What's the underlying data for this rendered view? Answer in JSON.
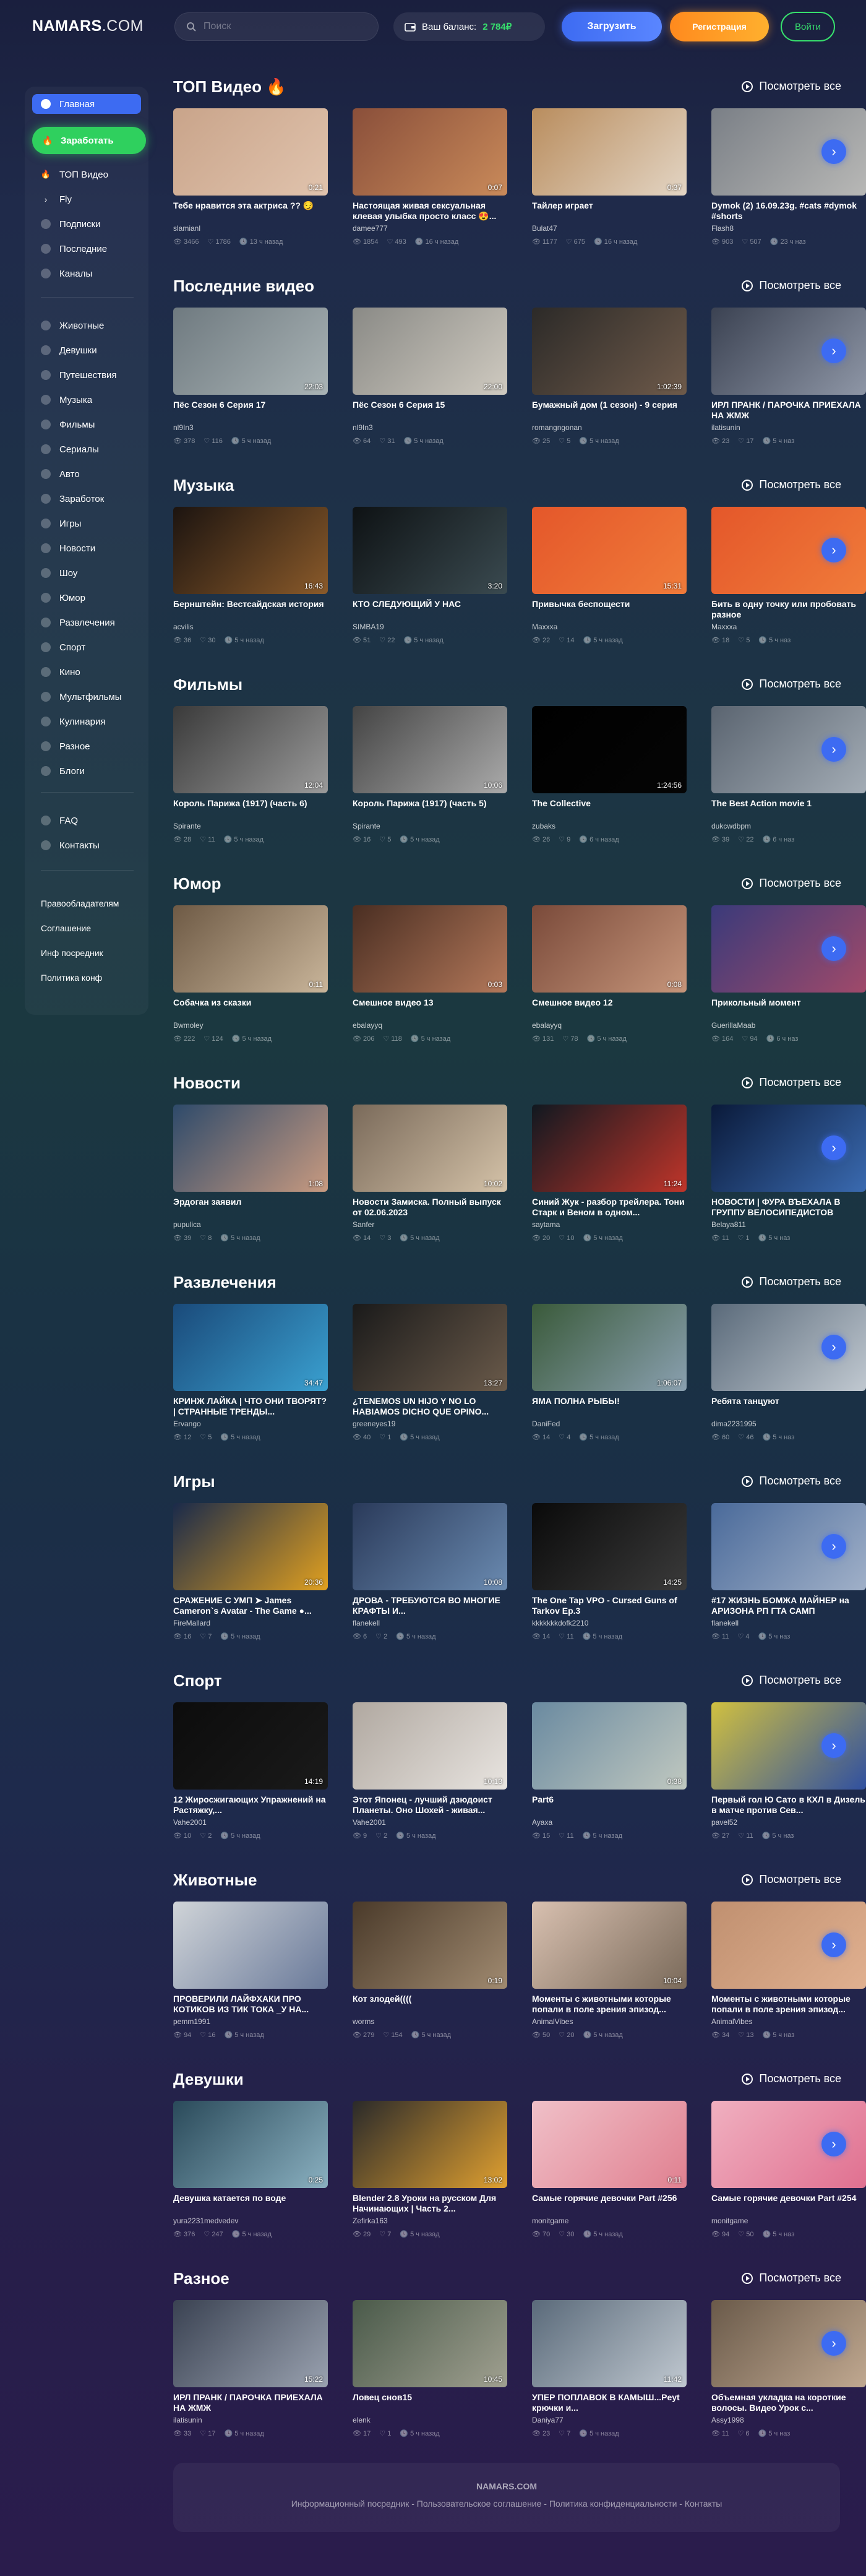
{
  "header": {
    "logo_main": "NAMARS",
    "logo_domain": ".COM",
    "search_placeholder": "Поиск",
    "balance_label": "Ваш баланс:",
    "balance_value": "2 784₽",
    "upload_label": "Загрузить",
    "register_label": "Регистрация",
    "login_label": "Войти"
  },
  "sidebar": {
    "main_items": [
      {
        "label": "Главная",
        "icon": "home-icon"
      },
      {
        "label": "Заработать",
        "icon": "fire-icon"
      },
      {
        "label": "ТОП Видео",
        "icon": "fire-icon"
      },
      {
        "label": "Fly",
        "icon": "chevron-icon"
      },
      {
        "label": "Подписки",
        "icon": "subscriptions-icon"
      },
      {
        "label": "Последние",
        "icon": "clock-icon"
      },
      {
        "label": "Каналы",
        "icon": "channels-icon"
      }
    ],
    "categories": [
      "Животные",
      "Девушки",
      "Путешествия",
      "Музыка",
      "Фильмы",
      "Сериалы",
      "Авто",
      "Заработок",
      "Игры",
      "Новости",
      "Шоу",
      "Юмор",
      "Развлечения",
      "Спорт",
      "Кино",
      "Мультфильмы",
      "Кулинария",
      "Разное",
      "Блоги"
    ],
    "info_items": [
      "FAQ",
      "Контакты"
    ],
    "legal_links": [
      "Правообладателям",
      "Соглашение",
      "Инф посредник",
      "Политика конф"
    ]
  },
  "see_all_label": "Посмотреть все",
  "sections": [
    {
      "title": "ТОП Видео 🔥",
      "videos": [
        {
          "title": "Тебе нравится эта актриса ?? 😏",
          "author": "slamianl",
          "views": "3466",
          "likes": "1786",
          "time": "13 ч назад",
          "duration": "0:21",
          "colors": [
            "#c9a48a",
            "#e0c3ad"
          ]
        },
        {
          "title": "Настоящая живая сексуальная клевая улыбка просто класс 😍...",
          "author": "damee777",
          "views": "1854",
          "likes": "493",
          "time": "16 ч назад",
          "duration": "0:07",
          "colors": [
            "#8a4f3a",
            "#c98a5a"
          ]
        },
        {
          "title": "Тайлер играет",
          "author": "Bulat47",
          "views": "1177",
          "likes": "675",
          "time": "16 ч назад",
          "duration": "0:37",
          "colors": [
            "#b98d5e",
            "#e3d5c4"
          ]
        },
        {
          "title": "Dymok (2) 16.09.23g. #cats #dymok #shorts",
          "author": "Flash8",
          "views": "903",
          "likes": "507",
          "time": "23 ч наз",
          "duration": "",
          "colors": [
            "#7a7f86",
            "#b8b8b6"
          ]
        }
      ]
    },
    {
      "title": "Последние видео",
      "videos": [
        {
          "title": "Пёс Сезон 6 Серия 17",
          "author": "nl9In3",
          "views": "378",
          "likes": "116",
          "time": "5 ч назад",
          "duration": "22:03",
          "colors": [
            "#6f7a80",
            "#a9b3b5"
          ]
        },
        {
          "title": "Пёс Сезон 6 Серия 15",
          "author": "nl9In3",
          "views": "64",
          "likes": "31",
          "time": "5 ч назад",
          "duration": "22:00",
          "colors": [
            "#8a8a86",
            "#cfcac0"
          ]
        },
        {
          "title": "Бумажный дом (1 сезон) - 9 серия",
          "author": "romangngonan",
          "views": "25",
          "likes": "5",
          "time": "5 ч назад",
          "duration": "1:02:39",
          "colors": [
            "#2c2a28",
            "#6e5a4a"
          ]
        },
        {
          "title": "ИРЛ ПРАНК / ПАРОЧКА ПРИЕХАЛА НА ЖМЖ",
          "author": "ilatisunin",
          "views": "23",
          "likes": "17",
          "time": "5 ч наз",
          "duration": "",
          "colors": [
            "#3b4252",
            "#8e96a6"
          ]
        }
      ]
    },
    {
      "title": "Музыка",
      "videos": [
        {
          "title": "Бернштейн: Вестсайдская история",
          "author": "acvilis",
          "views": "36",
          "likes": "30",
          "time": "5 ч назад",
          "duration": "16:43",
          "colors": [
            "#1c1410",
            "#8a5a2a"
          ]
        },
        {
          "title": "КТО СЛЕДУЮЩИЙ У НАС",
          "author": "SIMBA19",
          "views": "51",
          "likes": "22",
          "time": "5 ч назад",
          "duration": "3:20",
          "colors": [
            "#0e1214",
            "#3a4a50"
          ]
        },
        {
          "title": "Привычка беспощести",
          "author": "Maxxxa",
          "views": "22",
          "likes": "14",
          "time": "5 ч назад",
          "duration": "15:31",
          "colors": [
            "#e4572a",
            "#f07b3a"
          ]
        },
        {
          "title": "Бить в одну точку или пробовать разное",
          "author": "Maxxxa",
          "views": "18",
          "likes": "5",
          "time": "5 ч наз",
          "duration": "",
          "colors": [
            "#e4572a",
            "#f07b3a"
          ]
        }
      ]
    },
    {
      "title": "Фильмы",
      "videos": [
        {
          "title": "Король Парижа (1917) (часть 6)",
          "author": "Spirante",
          "views": "28",
          "likes": "11",
          "time": "5 ч назад",
          "duration": "12:04",
          "colors": [
            "#3a3a3a",
            "#9a9a9a"
          ]
        },
        {
          "title": "Король Парижа (1917) (часть 5)",
          "author": "Spirante",
          "views": "16",
          "likes": "5",
          "time": "5 ч назад",
          "duration": "10:06",
          "colors": [
            "#444",
            "#aaa"
          ]
        },
        {
          "title": "The Collective",
          "author": "zubaks",
          "views": "26",
          "likes": "9",
          "time": "6 ч назад",
          "duration": "1:24:56",
          "colors": [
            "#000000",
            "#050505"
          ]
        },
        {
          "title": "The Best Action movie 1",
          "author": "dukcwdbpm",
          "views": "39",
          "likes": "22",
          "time": "6 ч наз",
          "duration": "",
          "colors": [
            "#5a6470",
            "#a3acb5"
          ]
        }
      ]
    },
    {
      "title": "Юмор",
      "videos": [
        {
          "title": "Собачка из сказки",
          "author": "Bwmoley",
          "views": "222",
          "likes": "124",
          "time": "5 ч назад",
          "duration": "0:11",
          "colors": [
            "#6e5a45",
            "#c9b59a"
          ]
        },
        {
          "title": "Смешное видео 13",
          "author": "ebalayyq",
          "views": "206",
          "likes": "118",
          "time": "5 ч назад",
          "duration": "0:03",
          "colors": [
            "#4a2e22",
            "#b3785a"
          ]
        },
        {
          "title": "Смешное видео 12",
          "author": "ebalayyq",
          "views": "131",
          "likes": "78",
          "time": "5 ч назад",
          "duration": "0:08",
          "colors": [
            "#7a4a3a",
            "#c6957a"
          ]
        },
        {
          "title": "Прикольный момент",
          "author": "GuerillaMaab",
          "views": "164",
          "likes": "94",
          "time": "6 ч наз",
          "duration": "",
          "colors": [
            "#3a3a7a",
            "#a04a6a"
          ]
        }
      ]
    },
    {
      "title": "Новости",
      "videos": [
        {
          "title": "Эрдоган заявил",
          "author": "pupulica",
          "views": "39",
          "likes": "8",
          "time": "5 ч назад",
          "duration": "1:08",
          "colors": [
            "#2e4a6a",
            "#c89a80"
          ]
        },
        {
          "title": "Новости Замиска. Полный выпуск от 02.06.2023",
          "author": "Sanfer",
          "views": "14",
          "likes": "3",
          "time": "5 ч назад",
          "duration": "10:02",
          "colors": [
            "#7a6a5a",
            "#d4c2a8"
          ]
        },
        {
          "title": "Синий Жук - разбор трейлера. Тони Старк и Веном в одном...",
          "author": "saytama",
          "views": "20",
          "likes": "10",
          "time": "5 ч назад",
          "duration": "11:24",
          "colors": [
            "#101820",
            "#c0352a"
          ]
        },
        {
          "title": "НОВОСТИ | ФУРА ВЪЕХАЛА В ГРУППУ ВЕЛОСИПЕДИСТОВ",
          "author": "Belaya811",
          "views": "11",
          "likes": "1",
          "time": "5 ч наз",
          "duration": "",
          "colors": [
            "#0a1a3a",
            "#3a6ab0"
          ]
        }
      ]
    },
    {
      "title": "Развлечения",
      "videos": [
        {
          "title": "КРИНЖ ЛАЙКА | ЧТО ОНИ ТВОРЯТ? | СТРАННЫЕ ТРЕНДЫ...",
          "author": "Ervango",
          "views": "12",
          "likes": "5",
          "time": "5 ч назад",
          "duration": "34:47",
          "colors": [
            "#1a4a7a",
            "#3aa0d0"
          ]
        },
        {
          "title": "¿TENEMOS UN HIJO Y NO LO HABIAMOS DICHO QUE OPINO...",
          "author": "greeneyes19",
          "views": "40",
          "likes": "1",
          "time": "5 ч назад",
          "duration": "13:27",
          "colors": [
            "#1a1a1a",
            "#6a5a4a"
          ]
        },
        {
          "title": "ЯМА ПОЛНА РЫБЫ!",
          "author": "DaniFed",
          "views": "14",
          "likes": "4",
          "time": "5 ч назад",
          "duration": "1:06:07",
          "colors": [
            "#3a5a3a",
            "#8aa0b0"
          ]
        },
        {
          "title": "Ребята танцуют",
          "author": "dima2231995",
          "views": "60",
          "likes": "46",
          "time": "5 ч наз",
          "duration": "",
          "colors": [
            "#5a6a7a",
            "#c0c8d0"
          ]
        }
      ]
    },
    {
      "title": "Игры",
      "videos": [
        {
          "title": "СРАЖЕНИЕ С УМП ➤ James Cameron`s Avatar - The Game ●...",
          "author": "FireMallard",
          "views": "16",
          "likes": "7",
          "time": "5 ч назад",
          "duration": "20:36",
          "colors": [
            "#1a2a4a",
            "#e0a020"
          ]
        },
        {
          "title": "ДРОВА - ТРЕБУЮТСЯ ВО МНОГИЕ КРАФТЫ И...",
          "author": "flanekell",
          "views": "6",
          "likes": "2",
          "time": "5 ч назад",
          "duration": "10:08",
          "colors": [
            "#2a3a5a",
            "#6a8ab0"
          ]
        },
        {
          "title": "The One Tap VPO - Cursed Guns of Tarkov Ep.3",
          "author": "kkkkkkkdofk2210",
          "views": "14",
          "likes": "11",
          "time": "5 ч назад",
          "duration": "14:25",
          "colors": [
            "#0a0a0a",
            "#3a3a3a"
          ]
        },
        {
          "title": "#17 ЖИЗНЬ БОМЖА МАЙНЕР на АРИЗОНА РП ГТА САМП",
          "author": "flanekell",
          "views": "11",
          "likes": "4",
          "time": "5 ч наз",
          "duration": "",
          "colors": [
            "#4a6a9a",
            "#a0b0c8"
          ]
        }
      ]
    },
    {
      "title": "Спорт",
      "videos": [
        {
          "title": "12 Жиросжигающих Упражнений на Растяжку,...",
          "author": "Vahe2001",
          "views": "10",
          "likes": "2",
          "time": "5 ч назад",
          "duration": "14:19",
          "colors": [
            "#0c0c0c",
            "#1a1a1a"
          ]
        },
        {
          "title": "Этот Японец - лучший дзюдоист Планеты. Оно Шохей - живая...",
          "author": "Vahe2001",
          "views": "9",
          "likes": "2",
          "time": "5 ч назад",
          "duration": "10:13",
          "colors": [
            "#b0a8a0",
            "#e8e4e0"
          ]
        },
        {
          "title": "Part6",
          "author": "Ayaxa",
          "views": "15",
          "likes": "11",
          "time": "5 ч назад",
          "duration": "0:38",
          "colors": [
            "#6a8aa0",
            "#c0c8c0"
          ]
        },
        {
          "title": "Первый гол Ю Сато в КХЛ в Дизель в матче против Сев...",
          "author": "pavel52",
          "views": "27",
          "likes": "11",
          "time": "5 ч наз",
          "duration": "",
          "colors": [
            "#d0c040",
            "#3050a0"
          ]
        }
      ]
    },
    {
      "title": "Животные",
      "videos": [
        {
          "title": "ПРОВЕРИЛИ ЛАЙФХАКИ ПРО КОТИКОВ ИЗ ТИК ТОКА _У НА...",
          "author": "pemm1991",
          "views": "94",
          "likes": "16",
          "time": "5 ч назад",
          "duration": "",
          "colors": [
            "#d0d4d8",
            "#6a7a9a"
          ]
        },
        {
          "title": "Кот злодей((((",
          "author": "worms",
          "views": "279",
          "likes": "154",
          "time": "5 ч назад",
          "duration": "0:19",
          "colors": [
            "#4a3a2a",
            "#a08a70"
          ]
        },
        {
          "title": "Моменты с животными которые попали в поле зрения эпизод...",
          "author": "AnimalVibes",
          "views": "50",
          "likes": "20",
          "time": "5 ч назад",
          "duration": "10:04",
          "colors": [
            "#d8c0b0",
            "#7a6a5a"
          ]
        },
        {
          "title": "Моменты с животными которые попали в поле зрения эпизод...",
          "author": "AnimalVibes",
          "views": "34",
          "likes": "13",
          "time": "5 ч наз",
          "duration": "",
          "colors": [
            "#c09070",
            "#e0b090"
          ]
        }
      ]
    },
    {
      "title": "Девушки",
      "videos": [
        {
          "title": "Девушка катается по воде",
          "author": "yura2231medvedev",
          "views": "376",
          "likes": "247",
          "time": "5 ч назад",
          "duration": "0:25",
          "colors": [
            "#2a4a5a",
            "#8ab0c0"
          ]
        },
        {
          "title": "Blender 2.8 Уроки на русском Для Начинающих | Часть 2...",
          "author": "Zefirka163",
          "views": "29",
          "likes": "7",
          "time": "5 ч назад",
          "duration": "13:02",
          "colors": [
            "#2a2a2a",
            "#e0a030"
          ]
        },
        {
          "title": "Самые горячие девочки Part #256",
          "author": "monitgame",
          "views": "70",
          "likes": "30",
          "time": "5 ч назад",
          "duration": "0:11",
          "colors": [
            "#f0c0c8",
            "#e08090"
          ]
        },
        {
          "title": "Самые горячие девочки Part #254",
          "author": "monitgame",
          "views": "94",
          "likes": "50",
          "time": "5 ч наз",
          "duration": "",
          "colors": [
            "#f0b0c0",
            "#e07090"
          ]
        }
      ]
    },
    {
      "title": "Разное",
      "videos": [
        {
          "title": "ИРЛ ПРАНК / ПАРОЧКА ПРИЕХАЛА НА ЖМЖ",
          "author": "ilatisunin",
          "views": "33",
          "likes": "17",
          "time": "5 ч назад",
          "duration": "15:22",
          "colors": [
            "#3a4252",
            "#9aa2b0"
          ]
        },
        {
          "title": "Ловец снов15",
          "author": "elenk",
          "views": "17",
          "likes": "1",
          "time": "5 ч назад",
          "duration": "10:45",
          "colors": [
            "#4a5a4a",
            "#a0a090"
          ]
        },
        {
          "title": "УПЕР ПОПЛАВОК В КАМЫШ...Peyt крючки и...",
          "author": "Daniya77",
          "views": "23",
          "likes": "7",
          "time": "5 ч назад",
          "duration": "11:42",
          "colors": [
            "#5a6a7a",
            "#c0c8d0"
          ]
        },
        {
          "title": "Объемная укладка на короткие волосы. Видео Урок с...",
          "author": "Assy1998",
          "views": "11",
          "likes": "6",
          "time": "5 ч наз",
          "duration": "",
          "colors": [
            "#6a5a4a",
            "#c0a890"
          ]
        }
      ]
    }
  ],
  "footer": {
    "brand": "NAMARS.COM",
    "links": "Информационный посредник - Пользовательское соглашение - Политика конфиденциальности - Контакты"
  }
}
